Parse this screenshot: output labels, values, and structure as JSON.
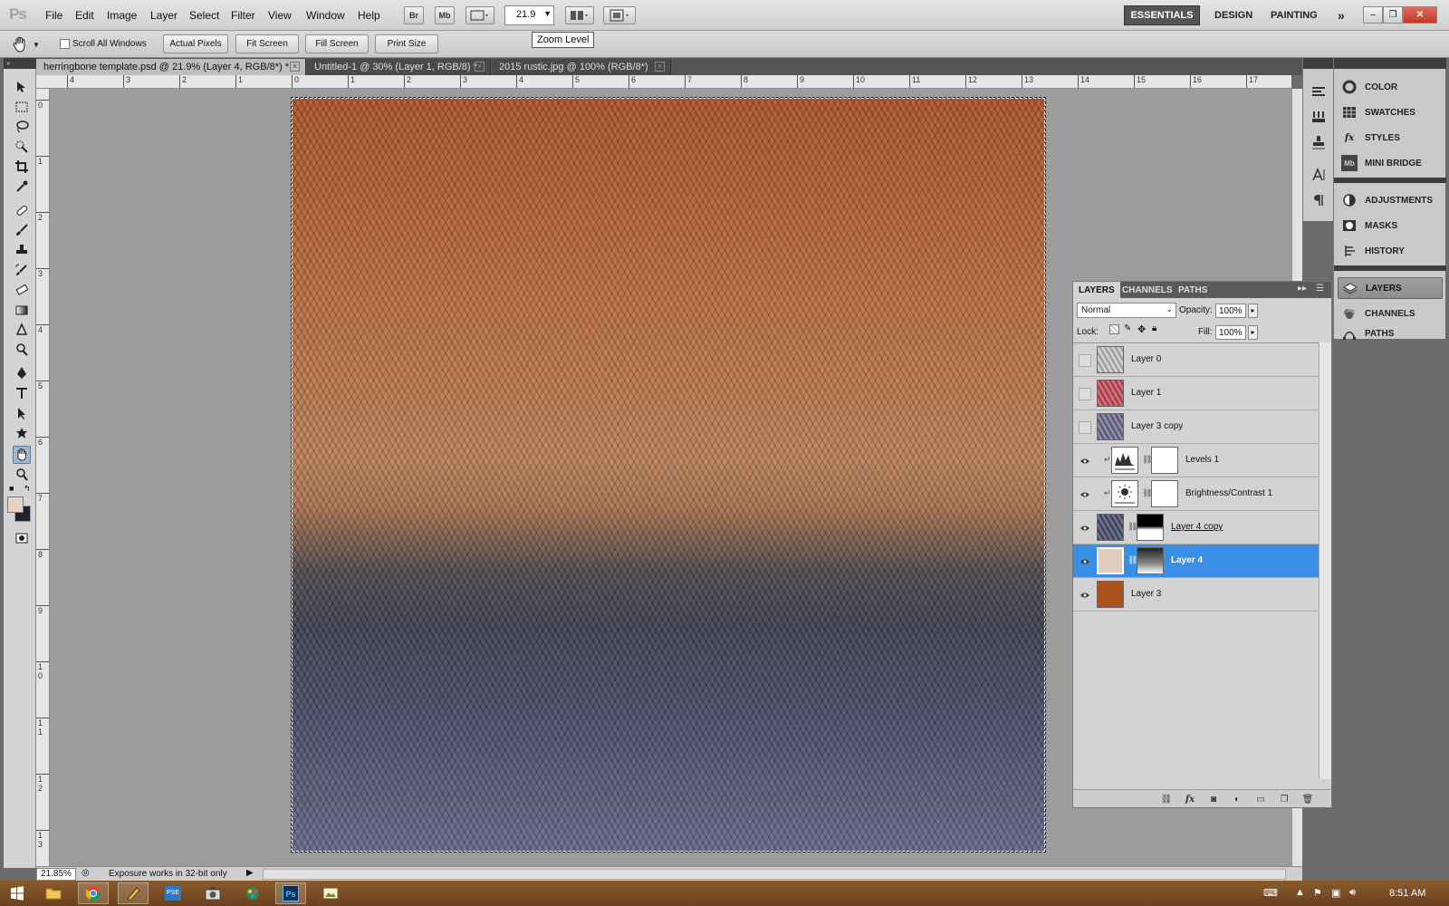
{
  "app": {
    "logo": "Ps"
  },
  "menu": [
    "File",
    "Edit",
    "Image",
    "Layer",
    "Select",
    "Filter",
    "View",
    "Window",
    "Help"
  ],
  "appbar": {
    "br": "Br",
    "mb": "Mb",
    "zoom_value": "21.9"
  },
  "workspaces": {
    "essentials": "ESSENTIALS",
    "design": "DESIGN",
    "painting": "PAINTING",
    "more": "»"
  },
  "options": {
    "scroll_all_windows": "Scroll All Windows",
    "actual_pixels": "Actual Pixels",
    "fit_screen": "Fit Screen",
    "fill_screen": "Fill Screen",
    "print_size": "Print Size"
  },
  "tooltip": "Zoom Level",
  "doc_tabs": [
    {
      "label": "herringbone template.psd @ 21.9% (Layer 4, RGB/8*) *"
    },
    {
      "label": "Untitled-1 @ 30% (Layer 1, RGB/8) *"
    },
    {
      "label": "2015 rustic.jpg @ 100% (RGB/8*)"
    }
  ],
  "ruler_top": [
    "4",
    "3",
    "2",
    "1",
    "0",
    "1",
    "2",
    "3",
    "4",
    "5",
    "6",
    "7",
    "8",
    "9",
    "10",
    "11",
    "12",
    "13",
    "14",
    "15",
    "16",
    "17"
  ],
  "ruler_left": [
    "0",
    "1",
    "2",
    "3",
    "4",
    "5",
    "6",
    "7",
    "8",
    "9",
    "1 0",
    "1 1",
    "1 2",
    "1 3"
  ],
  "status": {
    "zoom": "21.85%",
    "message": "Exposure works in 32-bit only"
  },
  "dock": [
    {
      "label": "COLOR",
      "icon": "color-icon"
    },
    {
      "label": "SWATCHES",
      "icon": "swatches-icon"
    },
    {
      "label": "STYLES",
      "icon": "styles-icon"
    },
    {
      "label": "MINI BRIDGE",
      "icon": "mini-bridge-icon"
    },
    {
      "label": "ADJUSTMENTS",
      "icon": "adjustments-icon"
    },
    {
      "label": "MASKS",
      "icon": "masks-icon"
    },
    {
      "label": "HISTORY",
      "icon": "history-icon"
    },
    {
      "label": "LAYERS",
      "icon": "layers-icon"
    },
    {
      "label": "CHANNELS",
      "icon": "channels-icon"
    },
    {
      "label": "PATHS",
      "icon": "paths-icon"
    }
  ],
  "layers_panel": {
    "tabs": [
      "LAYERS",
      "CHANNELS",
      "PATHS"
    ],
    "blend_mode": "Normal",
    "opacity_label": "Opacity:",
    "opacity": "100%",
    "lock_label": "Lock:",
    "fill_label": "Fill:",
    "fill": "100%",
    "layers": [
      {
        "name": "Layer 0",
        "visible": false,
        "thumb": "#bdbdbd"
      },
      {
        "name": "Layer 1",
        "visible": false,
        "thumb": "#c0505e"
      },
      {
        "name": "Layer 3 copy",
        "visible": false,
        "thumb": "#6e6e86"
      },
      {
        "name": "Levels 1",
        "visible": true,
        "adjustment": "levels"
      },
      {
        "name": "Brightness/Contrast 1",
        "visible": true,
        "adjustment": "brightness"
      },
      {
        "name": "Layer 4 copy",
        "visible": true,
        "thumb": "#4a4f66"
      },
      {
        "name": "Layer 4",
        "visible": true,
        "thumb": "#e0cbbf",
        "selected": true
      },
      {
        "name": "Layer 3",
        "visible": true,
        "thumb": "#a9531f"
      }
    ]
  },
  "colors": {
    "accent": "#3a8ee6",
    "foreground": "#e5d2c6",
    "background": "#202030"
  },
  "clock": "8:51 AM"
}
